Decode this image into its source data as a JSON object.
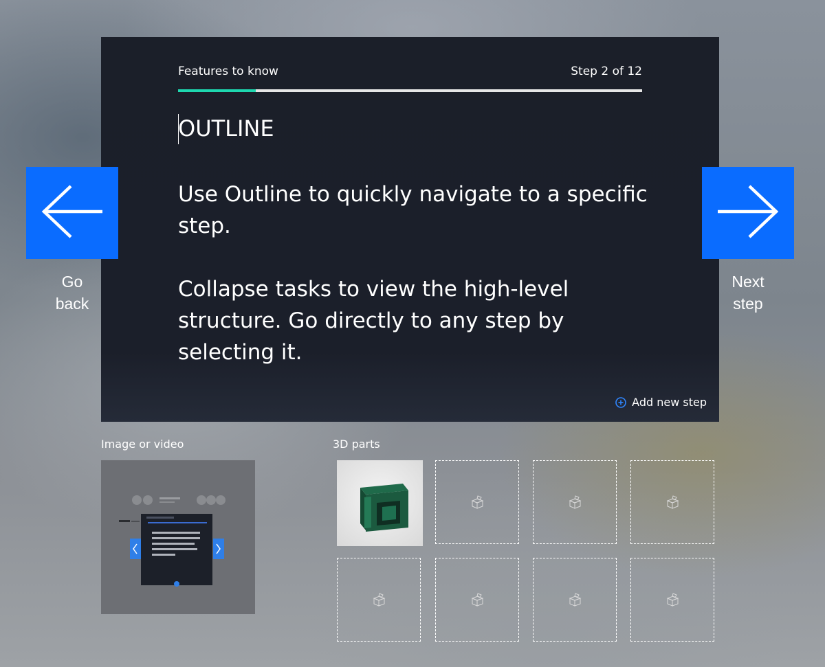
{
  "card": {
    "header_left": "Features to know",
    "header_right": "Step 2 of 12",
    "progress": 0.167,
    "title": "OUTLINE",
    "paragraphs": [
      "Use Outline to quickly navigate to a specific step.",
      "Collapse tasks to view the high-level structure. Go directly to any step by selecting it."
    ],
    "add_step_label": "Add new step"
  },
  "nav": {
    "back_label_1": "Go",
    "back_label_2": "back",
    "next_label_1": "Next",
    "next_label_2": "step"
  },
  "media": {
    "label": "Image or video"
  },
  "parts": {
    "label": "3D parts",
    "empty_slot_icon": "cube-outline-icon",
    "filled_slot_icon": "green-3d-part"
  },
  "colors": {
    "accent_blue": "#0a6cff",
    "progress_teal": "#1ed8b0",
    "card_bg": "#1b1f29"
  }
}
